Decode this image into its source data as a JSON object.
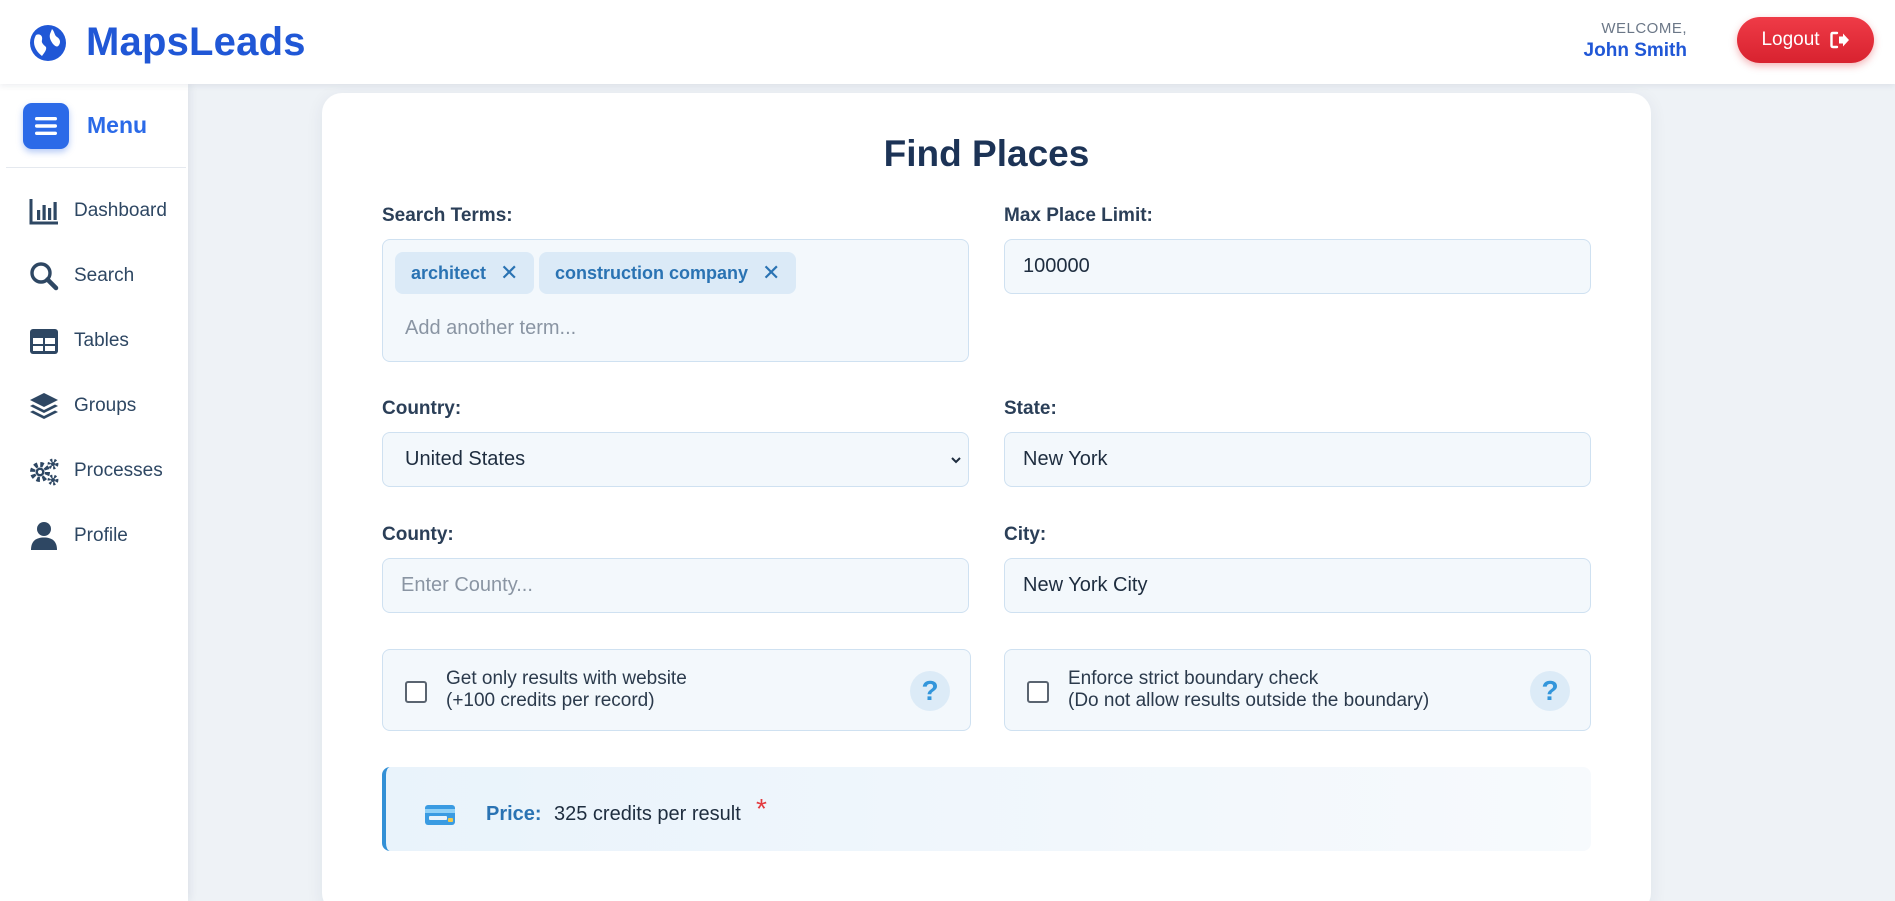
{
  "header": {
    "brand": "MapsLeads",
    "welcome_label": "WELCOME,",
    "user_name": "John Smith",
    "logout_label": "Logout"
  },
  "sidebar": {
    "menu_label": "Menu",
    "items": [
      {
        "label": "Dashboard",
        "icon": "chart-bar-icon"
      },
      {
        "label": "Search",
        "icon": "search-icon"
      },
      {
        "label": "Tables",
        "icon": "table-icon"
      },
      {
        "label": "Groups",
        "icon": "layers-icon"
      },
      {
        "label": "Processes",
        "icon": "gears-icon"
      },
      {
        "label": "Profile",
        "icon": "user-icon"
      }
    ]
  },
  "form": {
    "title": "Find Places",
    "search_terms_label": "Search Terms:",
    "tags": [
      "architect",
      "construction company"
    ],
    "tag_remove_symbol": "✕",
    "tag_placeholder": "Add another term...",
    "max_limit_label": "Max Place Limit:",
    "max_limit_value": "100000",
    "country_label": "Country:",
    "country_value": "United States",
    "state_label": "State:",
    "state_value": "New York",
    "county_label": "County:",
    "county_placeholder": "Enter County...",
    "city_label": "City:",
    "city_value": "New York City",
    "website_check_line1": "Get only results with website",
    "website_check_line2": "(+100 credits per record)",
    "boundary_check_line1": "Enforce strict boundary check",
    "boundary_check_line2": "(Do not allow results outside the boundary)",
    "help_symbol": "?",
    "price_label": "Price:",
    "price_value": "325 credits per result",
    "price_required": "*"
  },
  "colors": {
    "brand": "#2057d6",
    "accent": "#2b6ae8",
    "danger": "#e33a3f",
    "price_border": "#3390d6"
  }
}
